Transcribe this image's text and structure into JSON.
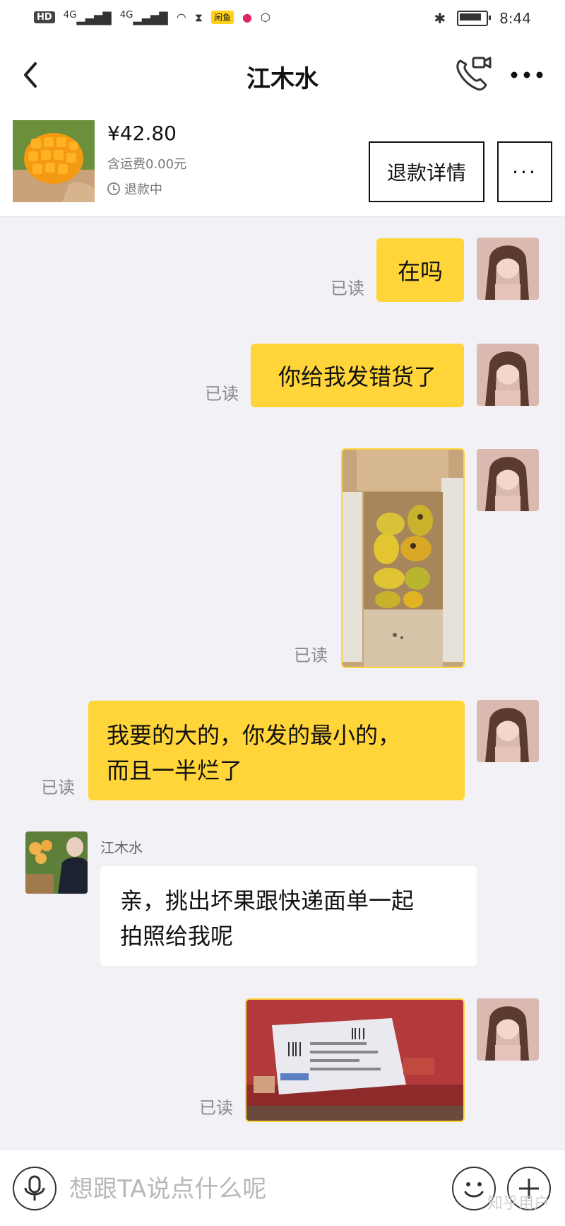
{
  "status_bar": {
    "hd_badge": "HD",
    "net1": "4G",
    "net2": "4G",
    "app_badge": "闲鱼",
    "time": "8:44"
  },
  "header": {
    "title": "江木水",
    "back_icon": "chevron-left-icon",
    "call_icon": "video-call-icon",
    "more_icon": "more-icon"
  },
  "product": {
    "price": "¥42.80",
    "shipping": "含运费0.00元",
    "status": "退款中",
    "refund_button": "退款详情",
    "more_button": "···"
  },
  "messages": [
    {
      "from": "me",
      "type": "text",
      "text": "在吗",
      "read": "已读"
    },
    {
      "from": "me",
      "type": "text",
      "text": "你给我发错货了",
      "read": "已读"
    },
    {
      "from": "me",
      "type": "image",
      "image": "mango-box-photo",
      "read": "已读"
    },
    {
      "from": "me",
      "type": "text",
      "lines": [
        "我要的大的，你发的最小的，",
        "而且一半烂了"
      ],
      "read": "已读"
    },
    {
      "from": "them",
      "type": "text",
      "sender": "江木水",
      "lines": [
        "亲，挑出坏果跟快递面单一起",
        "拍照给我呢"
      ]
    },
    {
      "from": "me",
      "type": "image",
      "image": "shipping-label-photo",
      "read": "已读"
    }
  ],
  "input": {
    "placeholder": "想跟TA说点什么呢"
  },
  "watermark": "知乎用户",
  "colors": {
    "bubble_me": "#ffd53a",
    "bubble_them": "#ffffff",
    "background": "#f2f2f6"
  }
}
